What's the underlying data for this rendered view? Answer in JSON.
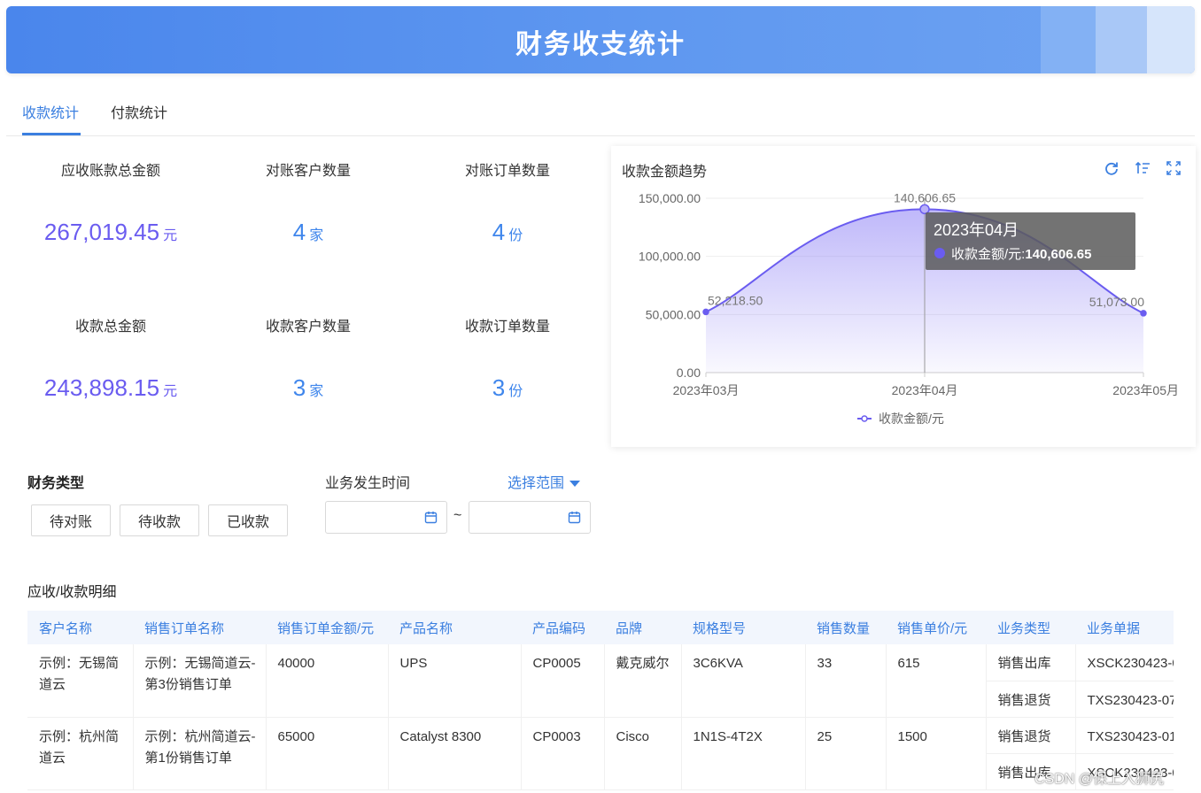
{
  "header": {
    "title": "财务收支统计"
  },
  "tabs": [
    {
      "label": "收款统计",
      "active": true
    },
    {
      "label": "付款统计",
      "active": false
    }
  ],
  "stats": {
    "receivable_total": {
      "label": "应收账款总金额",
      "value": "267,019.45",
      "unit": "元"
    },
    "recon_customers": {
      "label": "对账客户数量",
      "value": "4",
      "unit": "家"
    },
    "recon_orders": {
      "label": "对账订单数量",
      "value": "4",
      "unit": "份"
    },
    "received_total": {
      "label": "收款总金额",
      "value": "243,898.15",
      "unit": "元"
    },
    "received_customers": {
      "label": "收款客户数量",
      "value": "3",
      "unit": "家"
    },
    "received_orders": {
      "label": "收款订单数量",
      "value": "3",
      "unit": "份"
    }
  },
  "chart": {
    "title": "收款金额趋势",
    "tooltip": {
      "title": "2023年04月",
      "series": "收款金额/元:",
      "value": "140,606.65"
    },
    "legend": "收款金额/元",
    "series_color": "#6a5cf0"
  },
  "chart_data": {
    "type": "line",
    "title": "收款金额趋势",
    "categories": [
      "2023年03月",
      "2023年04月",
      "2023年05月"
    ],
    "series": [
      {
        "name": "收款金额/元",
        "values": [
          52218.5,
          140606.65,
          51073.0
        ]
      }
    ],
    "data_labels": [
      "52,218.50",
      "140,606.65",
      "51,073.00"
    ],
    "yticks": [
      "0.00",
      "50,000.00",
      "100,000.00",
      "150,000.00"
    ],
    "ylim": [
      0,
      150000
    ],
    "smooth": true,
    "area_fill": true,
    "legend_position": "bottom-center"
  },
  "filters": {
    "finance_type_label": "财务类型",
    "buttons": [
      "待对账",
      "待收款",
      "已收款"
    ],
    "time_label": "业务发生时间",
    "range_link": "选择范围",
    "tilde": "~"
  },
  "table": {
    "section_title": "应收/收款明细",
    "columns": [
      "客户名称",
      "销售订单名称",
      "销售订单金额/元",
      "产品名称",
      "产品编码",
      "品牌",
      "规格型号",
      "销售数量",
      "销售单价/元",
      "业务类型",
      "业务单据"
    ],
    "rows": [
      {
        "customer": "示例：无锡简道云",
        "order": "示例：无锡简道云-第3份销售订单",
        "amount": "40000",
        "product": "UPS",
        "code": "CP0005",
        "brand": "戴克威尔",
        "model": "3C6KVA",
        "qty": "33",
        "price": "615",
        "subs": [
          {
            "type": "销售出库",
            "doc": "XSCK230423-0"
          },
          {
            "type": "销售退货",
            "doc": "TXS230423-07"
          }
        ]
      },
      {
        "customer": "示例：杭州简道云",
        "order": "示例：杭州简道云-第1份销售订单",
        "amount": "65000",
        "product": "Catalyst 8300",
        "code": "CP0003",
        "brand": "Cisco",
        "model": "1N1S-4T2X",
        "qty": "25",
        "price": "1500",
        "subs": [
          {
            "type": "销售退货",
            "doc": "TXS230423-01"
          },
          {
            "type": "销售出库",
            "doc": "XSCK230423-0"
          }
        ]
      }
    ]
  },
  "watermark": "CSDN @保上入狮尻"
}
